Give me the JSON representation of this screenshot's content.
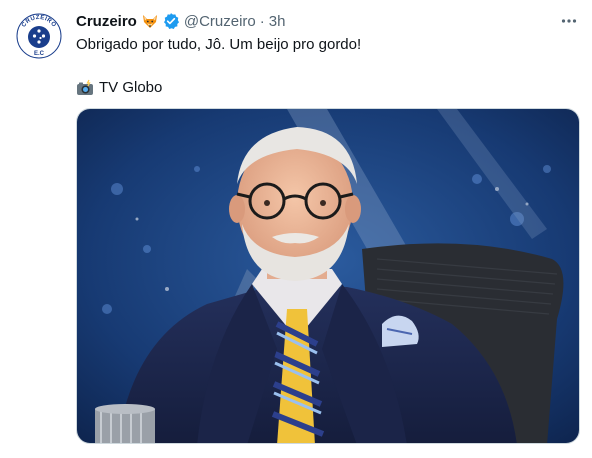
{
  "tweet": {
    "author_name": "Cruzeiro",
    "author_handle": "@Cruzeiro",
    "separator": "·",
    "time": "3h",
    "text": "Obrigado por tudo, Jô. Um beijo pro gordo!",
    "credit": "TV Globo",
    "avatar_text_top": "CRUZEIRO",
    "avatar_text_bottom": "E.C"
  },
  "icons": {
    "name_emoji": "fox-face-icon",
    "verified": "verified-badge-icon",
    "more": "more-options-icon",
    "camera": "camera-with-flash-icon"
  },
  "colors": {
    "accent": "#1d9bf0",
    "cruzeiro_blue": "#1a3e8c",
    "muted_text": "#536471",
    "text": "#0f1419"
  }
}
